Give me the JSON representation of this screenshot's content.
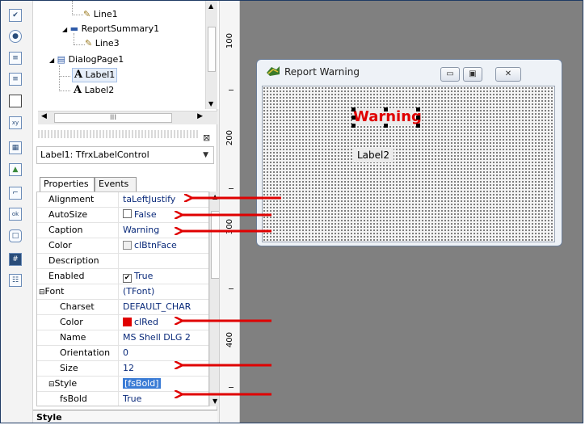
{
  "tree": {
    "items": [
      {
        "label": "Line1"
      },
      {
        "label": "ReportSummary1"
      },
      {
        "label": "Line3"
      },
      {
        "label": "DialogPage1"
      },
      {
        "label": "Label1"
      },
      {
        "label": "Label2"
      }
    ],
    "scroll_glyph": "III"
  },
  "component_combo": {
    "value": "Label1: TfrxLabelControl"
  },
  "inspector": {
    "tabs": [
      "Properties",
      "Events"
    ],
    "rows": [
      {
        "name": "Alignment",
        "value": "taLeftJustify"
      },
      {
        "name": "AutoSize",
        "value": "False"
      },
      {
        "name": "Caption",
        "value": "Warning"
      },
      {
        "name": "Color",
        "value": "clBtnFace"
      },
      {
        "name": "Description",
        "value": ""
      },
      {
        "name": "Enabled",
        "value": "True"
      },
      {
        "name": "Font",
        "value": "(TFont)"
      },
      {
        "name": "Charset",
        "value": "DEFAULT_CHAR"
      },
      {
        "name": "Color",
        "value": "clRed"
      },
      {
        "name": "Name",
        "value": "MS Shell DLG 2"
      },
      {
        "name": "Orientation",
        "value": "0"
      },
      {
        "name": "Size",
        "value": "12"
      },
      {
        "name": "Style",
        "value": "[fsBold]"
      },
      {
        "name": "fsBold",
        "value": "True"
      }
    ],
    "footer": "Style",
    "colors": {
      "clRed": "#e00000",
      "clBtnFace": "#efefef"
    }
  },
  "ruler": {
    "labels": [
      "100",
      "200",
      "300",
      "400"
    ]
  },
  "dialog": {
    "title": "Report Warning",
    "warning_label": "Warning",
    "label2": "Label2",
    "warning_color": "#e00000"
  },
  "icons": [
    "checkbox-icon",
    "radio-icon",
    "spin-edit-icon",
    "spin-edit2-icon",
    "panel-icon",
    "groupbox-icon",
    "grid-icon",
    "image-icon",
    "bevel-icon",
    "ok-button-icon",
    "shape-icon",
    "edit-icon",
    "listbox-icon",
    "close-x-icon",
    "pencil-icon",
    "report-band-icon",
    "dialog-page-icon",
    "label-a-icon",
    "expand-icon",
    "collapse-icon",
    "app-icon",
    "minimize-icon",
    "maximize-icon",
    "close-icon"
  ]
}
